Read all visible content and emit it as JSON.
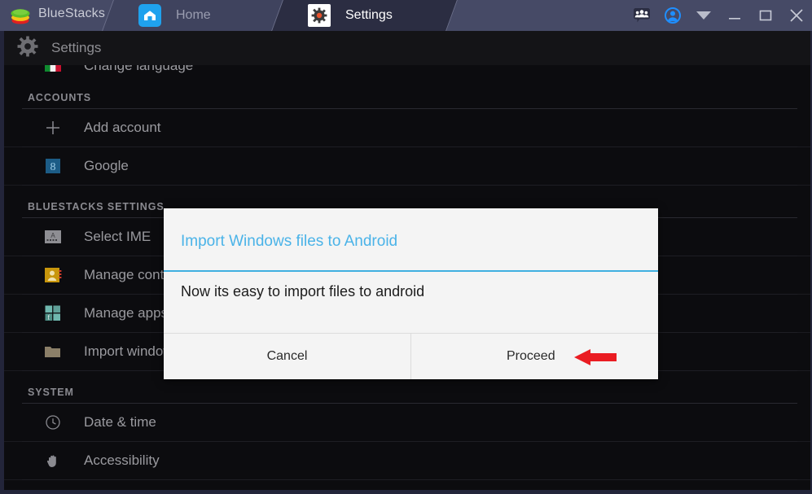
{
  "window": {
    "brand": "BlueStacks",
    "logo_icon": "bluestacks-logo-icon",
    "tabs": [
      {
        "label": "Home",
        "icon": "home-icon",
        "active": false
      },
      {
        "label": "Settings",
        "icon": "gear-icon",
        "active": true
      }
    ],
    "controls": [
      {
        "name": "community-icon",
        "glyph": "community"
      },
      {
        "name": "account-icon",
        "glyph": "account"
      },
      {
        "name": "chevron-down-icon",
        "glyph": "chevron"
      },
      {
        "name": "minimize-button",
        "glyph": "minimize"
      },
      {
        "name": "maximize-button",
        "glyph": "maximize"
      },
      {
        "name": "close-button",
        "glyph": "close"
      }
    ]
  },
  "actionbar": {
    "title": "Settings",
    "icon": "settings-gear-icon"
  },
  "settings_list": [
    {
      "type": "row",
      "label": "Change language",
      "icon": "italy-flag-icon",
      "cropped": true
    },
    {
      "type": "section",
      "label": "ACCOUNTS"
    },
    {
      "type": "row",
      "label": "Add account",
      "icon": "plus-icon"
    },
    {
      "type": "row",
      "label": "Google",
      "icon": "google-icon"
    },
    {
      "type": "section",
      "label": "BLUESTACKS SETTINGS"
    },
    {
      "type": "row",
      "label": "Select IME",
      "icon": "keyboard-icon"
    },
    {
      "type": "row",
      "label": "Manage contacts",
      "icon": "contacts-icon"
    },
    {
      "type": "row",
      "label": "Manage apps",
      "icon": "apps-grid-icon"
    },
    {
      "type": "row",
      "label": "Import windows files",
      "icon": "folder-icon"
    },
    {
      "type": "section",
      "label": "SYSTEM"
    },
    {
      "type": "row",
      "label": "Date & time",
      "icon": "clock-icon"
    },
    {
      "type": "row",
      "label": "Accessibility",
      "icon": "hand-icon"
    }
  ],
  "dialog": {
    "title": "Import Windows files to Android",
    "body": "Now its easy to import files to android",
    "cancel_label": "Cancel",
    "proceed_label": "Proceed",
    "accent_color": "#3fb0e0",
    "title_color": "#4ab3e8"
  },
  "annotation": {
    "arrow_icon": "red-arrow-left-icon",
    "arrow_color": "#ea1c22"
  }
}
